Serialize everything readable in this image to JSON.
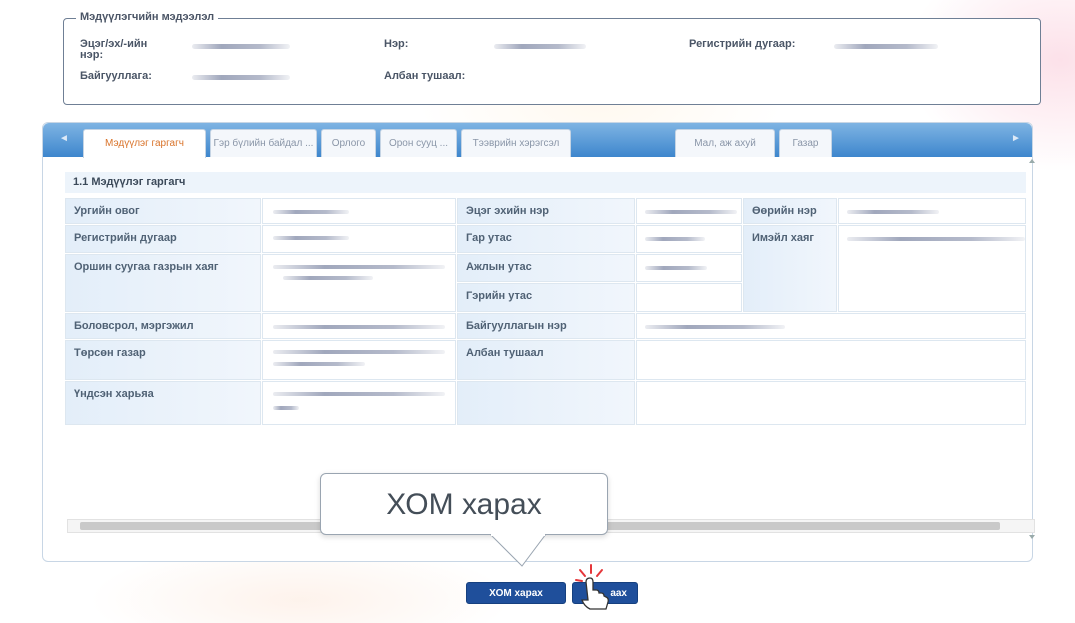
{
  "info": {
    "legend": "Мэдүүлэгчийн мэдээлэл",
    "labels": {
      "father_name": "Эцэг/эх/-ийн нэр:",
      "name": "Нэр:",
      "register": "Регистрийн дугаар:",
      "organization": "Байгууллага:",
      "position": "Албан тушаал:"
    }
  },
  "tabs": [
    {
      "label": "Мэдүүлэг гаргагч",
      "active": true
    },
    {
      "label": "Гэр бүлийн байдал ...",
      "active": false
    },
    {
      "label": "Орлого",
      "active": false
    },
    {
      "label": "Орон сууц ...",
      "active": false
    },
    {
      "label": "Тээврийн хэрэгсэл",
      "active": false
    },
    {
      "label": "Мал, аж ахуй",
      "active": false
    },
    {
      "label": "Газар",
      "active": false
    }
  ],
  "section": {
    "title": "1.1 Мэдүүлэг гаргагч",
    "labels": {
      "family_name": "Ургийн овог",
      "register": "Регистрийн дугаар",
      "address": "Оршин суугаа газрын хаяг",
      "education": "Боловсрол, мэргэжил",
      "birthplace": "Төрсөн газар",
      "ethnicity": "Үндсэн харьяа",
      "father_name": "Эцэг эхийн нэр",
      "mobile": "Гар утас",
      "work_phone": "Ажлын утас",
      "home_phone": "Гэрийн утас",
      "workplace": "Байгууллагын нэр",
      "position": "Албан тушаал",
      "own_name": "Өөрийн нэр",
      "email": "Имэйл хаяг"
    }
  },
  "callout": "ХОМ харах",
  "buttons": {
    "view": "ХОМ харах",
    "second_suffix": "аах"
  }
}
